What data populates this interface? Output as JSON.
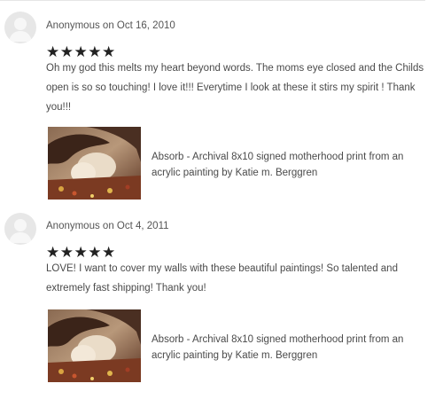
{
  "reviews": [
    {
      "reviewer": "Anonymous on Oct 16, 2010",
      "stars": "★★★★★",
      "rating": 5,
      "text": "Oh my god this melts my heart beyond words. The moms eye closed and the Childs open is so so touching! I love it!!! Everytime I look at these it stirs my spirit ! Thank you!!!",
      "product_title": "Absorb - Archival 8x10 signed motherhood print from an acrylic painting by Katie m. Berggren"
    },
    {
      "reviewer": "Anonymous on Oct 4, 2011",
      "stars": "★★★★★",
      "rating": 5,
      "text": "LOVE! I want to cover my walls with these beautiful paintings! So talented and extremely fast shipping! Thank you!",
      "product_title": "Absorb - Archival 8x10 signed motherhood print from an acrylic painting by Katie m. Berggren"
    }
  ]
}
